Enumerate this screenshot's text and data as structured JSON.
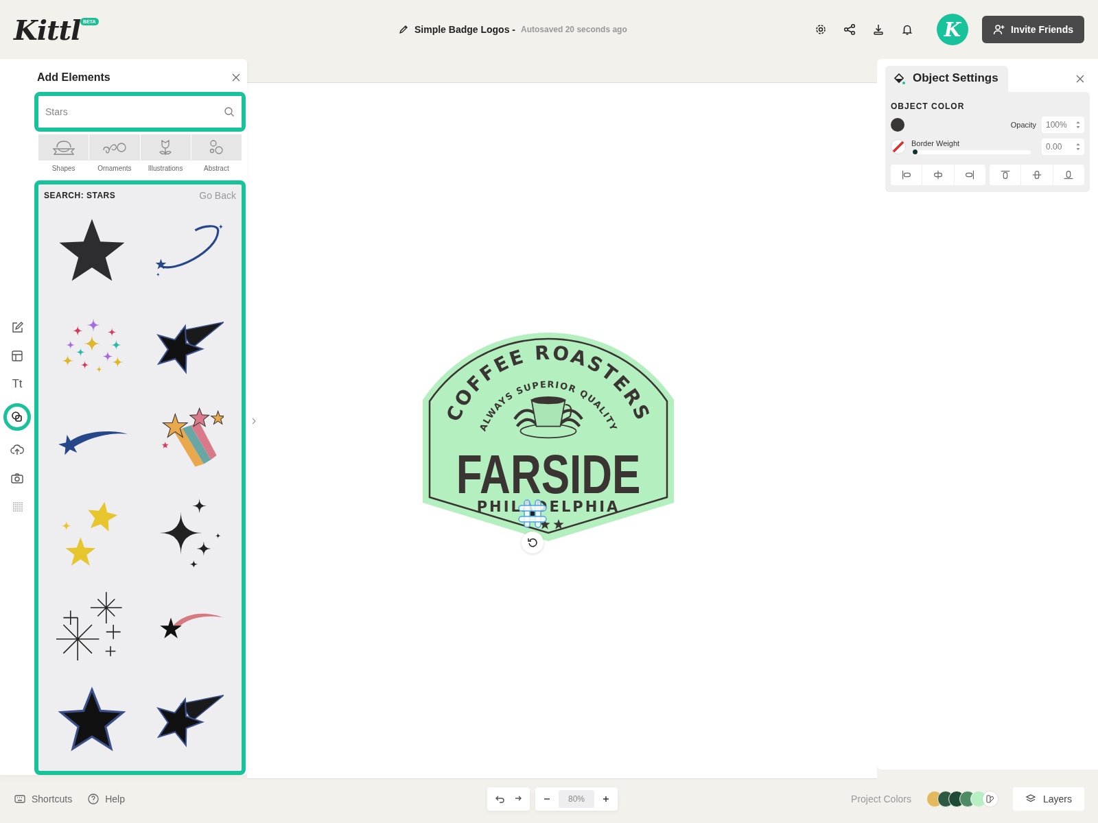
{
  "header": {
    "logo": "Kittl",
    "logo_badge": "BETA",
    "document_title": "Simple Badge Logos -",
    "autosave": "Autosaved 20 seconds ago",
    "avatar_letter": "K",
    "invite_button": "Invite Friends"
  },
  "rail": [
    {
      "kind": "edit",
      "selected": false
    },
    {
      "kind": "layout",
      "selected": false
    },
    {
      "kind": "text",
      "label": "Tt",
      "selected": false
    },
    {
      "kind": "elements",
      "selected": true
    },
    {
      "kind": "upload",
      "selected": false
    },
    {
      "kind": "camera",
      "selected": false
    },
    {
      "kind": "dots",
      "selected": false
    }
  ],
  "add_elements": {
    "title": "Add Elements",
    "search": {
      "value": "Stars"
    },
    "categories": [
      {
        "kind": "shapes",
        "label": "Shapes"
      },
      {
        "kind": "ornaments",
        "label": "Ornaments"
      },
      {
        "kind": "illustrations",
        "label": "Illustrations"
      },
      {
        "kind": "abstract",
        "label": "Abstract"
      }
    ],
    "results": {
      "heading": "SEARCH: STARS",
      "back": "Go Back",
      "items": [
        {
          "kind": "star"
        },
        {
          "kind": "orbit"
        },
        {
          "kind": "confetti"
        },
        {
          "kind": "shooting-star"
        },
        {
          "kind": "comet"
        },
        {
          "kind": "rainbow-stars"
        },
        {
          "kind": "bursts"
        },
        {
          "kind": "sparkles"
        },
        {
          "kind": "twinkles"
        },
        {
          "kind": "trail-star"
        },
        {
          "kind": "outline-star"
        },
        {
          "kind": "shooting-star"
        }
      ]
    }
  },
  "canvas": {
    "badge": {
      "arc_top": "COFFEE ROASTERS",
      "arc_inner": "ALWAYS SUPERIOR QUALITY",
      "name": "FARSIDE",
      "city": "PHILADELPHIA"
    }
  },
  "object_settings": {
    "title": "Object Settings",
    "section": "OBJECT COLOR",
    "opacity_label": "Opacity",
    "opacity_value": "100%",
    "border_label": "Border Weight",
    "border_value": "0.00",
    "border_slider": {
      "level": 0
    },
    "align": [
      {
        "kind": "left"
      },
      {
        "kind": "hcenter"
      },
      {
        "kind": "right"
      },
      {
        "kind": "top"
      },
      {
        "kind": "vcenter"
      },
      {
        "kind": "bottom"
      }
    ]
  },
  "footer": {
    "shortcuts": "Shortcuts",
    "help": "Help",
    "zoom": "80%",
    "project_colors_label": "Project Colors",
    "project_colors": [
      {
        "color": "#e4b95e"
      },
      {
        "color": "#2c5a43"
      },
      {
        "color": "#1f4a35"
      },
      {
        "color": "#4e8a64"
      },
      {
        "color": "#b6f0c2"
      }
    ],
    "layers": "Layers"
  }
}
